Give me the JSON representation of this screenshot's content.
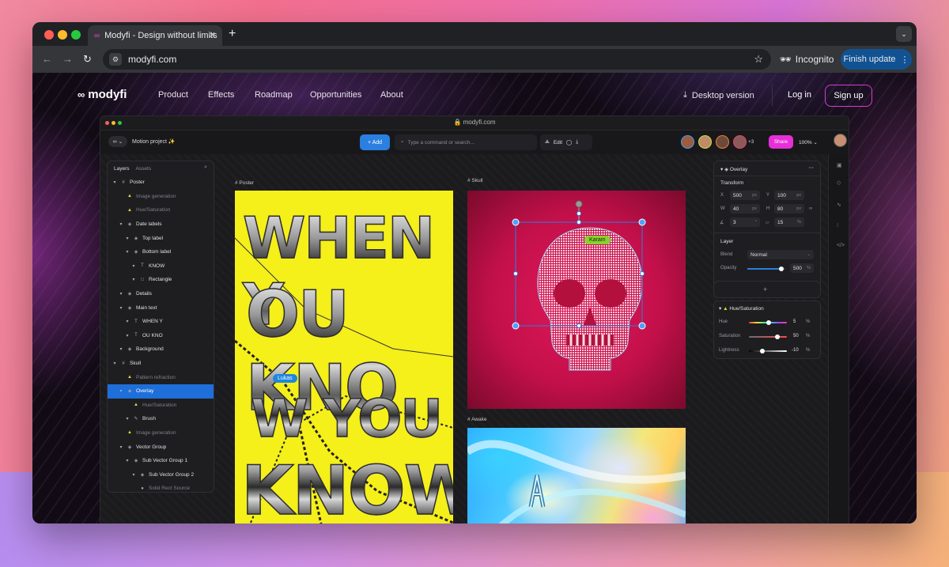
{
  "browser": {
    "tab_title": "Modyfi - Design without limits",
    "tab_favicon": "modyfi-logo-icon",
    "url": "modyfi.com",
    "incognito_label": "Incognito",
    "finish_update_label": "Finish update"
  },
  "site": {
    "logo_text": "modyfi",
    "nav": [
      "Product",
      "Effects",
      "Roadmap",
      "Opportunities",
      "About"
    ],
    "desktop_label": "Desktop version",
    "login_label": "Log in",
    "signup_label": "Sign up"
  },
  "app": {
    "url": "modyfi.com",
    "project_name": "Motion project ✨",
    "add_label": "+ Add",
    "search_placeholder": "Type a command or search...",
    "edit_label": "Edit",
    "more_count": "+3",
    "share_label": "Share",
    "zoom": "100%",
    "layers_tab": "Layers",
    "assets_tab": "Assets",
    "layers": [
      {
        "label": "Poster",
        "indent": 0,
        "icon": "#",
        "dim": false,
        "sel": false
      },
      {
        "label": "Image generation",
        "indent": 1,
        "icon": "▲",
        "dim": true,
        "sel": false
      },
      {
        "label": "Hue/Saturation",
        "indent": 1,
        "icon": "▲",
        "dim": true,
        "sel": false
      },
      {
        "label": "Date labels",
        "indent": 1,
        "icon": "◈",
        "dim": false,
        "sel": false
      },
      {
        "label": "Top label",
        "indent": 2,
        "icon": "◈",
        "dim": false,
        "sel": false
      },
      {
        "label": "Bottom label",
        "indent": 2,
        "icon": "◈",
        "dim": false,
        "sel": false
      },
      {
        "label": "KNOW",
        "indent": 3,
        "icon": "T",
        "dim": false,
        "sel": false
      },
      {
        "label": "Rectangle",
        "indent": 3,
        "icon": "□",
        "dim": false,
        "sel": false
      },
      {
        "label": "Details",
        "indent": 1,
        "icon": "◈",
        "dim": false,
        "sel": false
      },
      {
        "label": "Main text",
        "indent": 1,
        "icon": "◈",
        "dim": false,
        "sel": false
      },
      {
        "label": "WHEN Y",
        "indent": 2,
        "icon": "T",
        "dim": false,
        "sel": false
      },
      {
        "label": "OU KNO",
        "indent": 2,
        "icon": "T",
        "dim": false,
        "sel": false
      },
      {
        "label": "Background",
        "indent": 1,
        "icon": "◈",
        "dim": false,
        "sel": false
      },
      {
        "label": "Skull",
        "indent": 0,
        "icon": "#",
        "dim": false,
        "sel": false
      },
      {
        "label": "Pattern refraction",
        "indent": 1,
        "icon": "▲",
        "dim": true,
        "sel": false
      },
      {
        "label": "Overlay",
        "indent": 1,
        "icon": "◈",
        "dim": false,
        "sel": true
      },
      {
        "label": "Hue/Saturation",
        "indent": 2,
        "icon": "▲",
        "dim": true,
        "sel": false
      },
      {
        "label": "Brush",
        "indent": 2,
        "icon": "✎",
        "dim": false,
        "sel": false
      },
      {
        "label": "Image generation",
        "indent": 1,
        "icon": "▲",
        "dim": true,
        "sel": false
      },
      {
        "label": "Vector Group",
        "indent": 1,
        "icon": "◈",
        "dim": false,
        "sel": false
      },
      {
        "label": "Sub Vector Group 1",
        "indent": 2,
        "icon": "◈",
        "dim": false,
        "sel": false
      },
      {
        "label": "Sub Vector Group 2",
        "indent": 3,
        "icon": "◈",
        "dim": false,
        "sel": false
      },
      {
        "label": "Solid Rect Source",
        "indent": 3,
        "icon": "●",
        "dim": true,
        "sel": false
      }
    ],
    "frames": {
      "poster_label": "Poster",
      "skull_label": "Skull",
      "awake_label": "Awake"
    },
    "cursors": {
      "lukas": "Lukas",
      "karam": "Karam"
    },
    "poster_text": {
      "line1": "WHEN Y",
      "line2": "OU KNO",
      "line3": "W YOU",
      "line4": "KNOW"
    },
    "props": {
      "title": "Overlay",
      "transform_label": "Transform",
      "x_label": "X",
      "x_value": "500",
      "x_unit": "px",
      "y_label": "Y",
      "y_value": "100",
      "y_unit": "px",
      "w_label": "W",
      "w_value": "40",
      "w_unit": "px",
      "h_label": "H",
      "h_value": "80",
      "h_unit": "px",
      "rot_value": "3",
      "rot_unit": "°",
      "skew_value": "15",
      "skew_unit": "%",
      "layer_label": "Layer",
      "blend_label": "Blend",
      "blend_value": "Normal",
      "opacity_label": "Opacity",
      "opacity_value": "500",
      "opacity_unit": "%",
      "opacity_level": 0.9,
      "add_label": "+",
      "hs_title": "Hue/Saturation",
      "hue_label": "Hue",
      "hue_value": "5",
      "hue_unit": "%",
      "hue_level": 0.52,
      "sat_label": "Saturation",
      "sat_value": "50",
      "sat_unit": "%",
      "sat_level": 0.75,
      "light_label": "Lightness",
      "light_value": "-10",
      "light_unit": "%",
      "light_level": 0.35
    }
  },
  "colors": {
    "accent_pink": "#e62fd8",
    "accent_blue": "#1e6fd9",
    "poster_yellow": "#f5ef1a",
    "skull_red": "#d41656"
  }
}
